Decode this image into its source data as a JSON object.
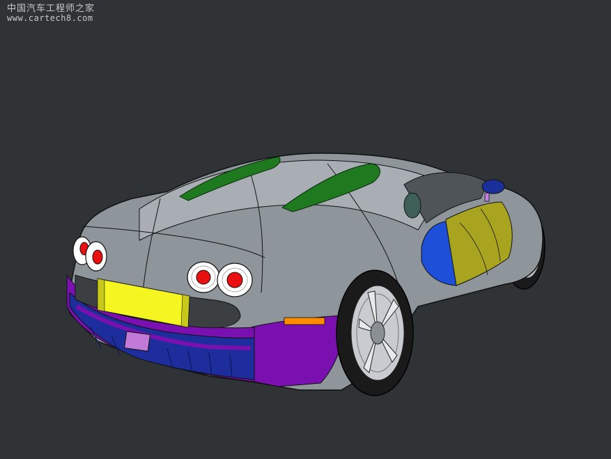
{
  "watermark": {
    "line1": "中国汽车工程师之家",
    "line2": "www.cartech8.com"
  },
  "colors": {
    "background": "#2f3336",
    "body": "#8e959b",
    "body_light": "#a8aeb3",
    "intake": "#1f7a1f",
    "rear_fascia": "#7a10b0",
    "diffuser": "#1d2d9b",
    "plate": "#f5f522",
    "door_panel": "#a8a420",
    "side_intake": "#1e4fd8",
    "tail_light": "#e81010",
    "marker": "#ff8c00"
  },
  "scene": {
    "object": "car-model"
  }
}
